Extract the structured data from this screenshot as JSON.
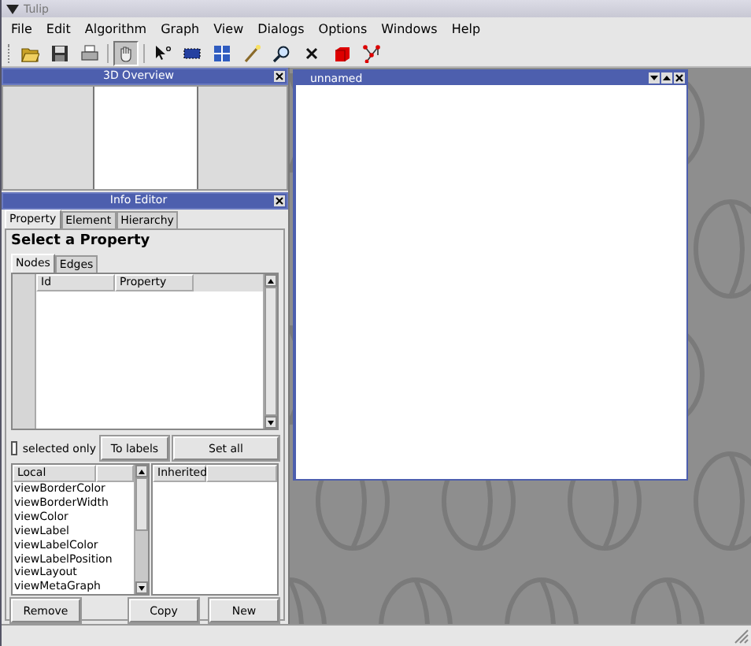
{
  "window": {
    "title": "Tulip"
  },
  "menu": [
    "File",
    "Edit",
    "Algorithm",
    "Graph",
    "View",
    "Dialogs",
    "Options",
    "Windows",
    "Help"
  ],
  "toolbar": [
    {
      "kind": "open",
      "selected": false
    },
    {
      "kind": "save",
      "selected": false
    },
    {
      "kind": "print",
      "selected": false
    },
    {
      "kind": "hand",
      "selected": true
    },
    {
      "kind": "pointer",
      "selected": false
    },
    {
      "kind": "rect",
      "selected": false
    },
    {
      "kind": "grid",
      "selected": false
    },
    {
      "kind": "wand",
      "selected": false
    },
    {
      "kind": "zoom",
      "selected": false
    },
    {
      "kind": "delete",
      "selected": false
    },
    {
      "kind": "cube",
      "selected": false
    },
    {
      "kind": "graph",
      "selected": false
    }
  ],
  "overview": {
    "title": "3D Overview"
  },
  "info_editor": {
    "title": "Info Editor",
    "tabs": [
      {
        "label": "Property",
        "selected": true
      },
      {
        "label": "Element",
        "selected": false
      },
      {
        "label": "Hierarchy",
        "selected": false
      }
    ],
    "heading": "Select a Property",
    "subtabs": [
      {
        "label": "Nodes",
        "selected": true
      },
      {
        "label": "Edges",
        "selected": false
      }
    ],
    "columns": [
      "Id",
      "Property"
    ],
    "selected_only": {
      "label": "selected only",
      "checked": false
    },
    "buttons": [
      "To labels",
      "Set all"
    ],
    "local": {
      "header": "Local",
      "items": [
        "viewBorderColor",
        "viewBorderWidth",
        "viewColor",
        "viewLabel",
        "viewLabelColor",
        "viewLabelPosition",
        "viewLayout",
        "viewMetaGraph"
      ]
    },
    "inherited": {
      "header": "Inherited"
    },
    "bottom_buttons": [
      "Remove",
      "Copy",
      "New"
    ]
  },
  "graph_window": {
    "title": "unnamed"
  }
}
